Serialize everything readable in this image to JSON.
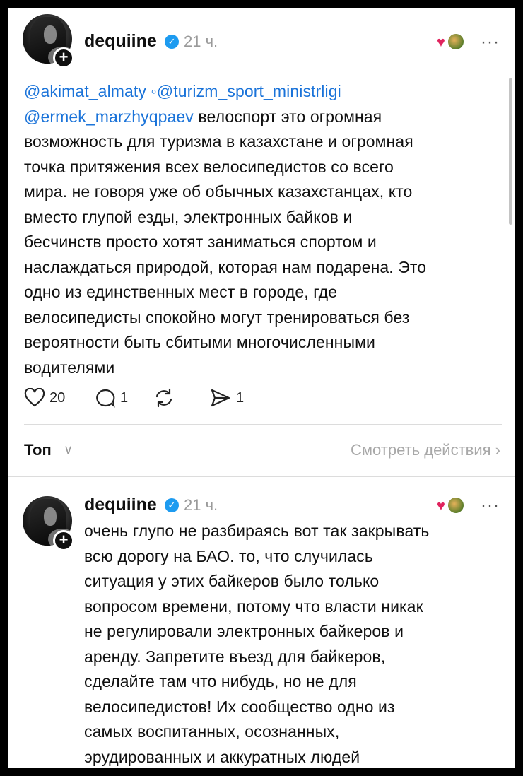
{
  "post": {
    "username": "dequiine",
    "time": "21 ч.",
    "more": "···",
    "mentions": [
      "@akimat_almaty",
      "@turizm_sport_ministrligi",
      "@ermek_marzhyqpaev"
    ],
    "lines": [
      " велоспорт это огромная",
      "возможность для туризма в казахстане и огромная",
      "точка притяжения всех велосипедистов со всего",
      "мира. не говоря уже об обычных казахстанцах, кто",
      "вместо глупой езды, электронных байков и",
      "бесчинств просто хотят заниматься спортом и",
      "наслаждаться природой, которая нам подарена. Это",
      "одно из единственных мест в городе, где",
      "велосипедисты спокойно могут тренироваться без",
      "вероятности быть сбитыми многочисленными",
      "водителями"
    ],
    "likes": "20",
    "comments": "1",
    "shares": "1"
  },
  "sort": {
    "label": "Топ",
    "chevron": "∨",
    "see_actions": "Смотреть действия ›"
  },
  "reply": {
    "username": "dequiine",
    "time": "21 ч.",
    "more": "···",
    "lines": [
      "очень глупо не разбираясь вот так закрывать",
      "всю дорогу на БАО. то, что случилась",
      "ситуация у этих байкеров было только",
      "вопросом времени, потому что власти никак",
      "не регулировали электронных байкеров и",
      "аренду. Запретите въезд для байкеров,",
      "сделайте там что нибудь, но не для",
      "велосипедистов! Их сообщество одно из",
      "самых воспитанных, осознанных,",
      "эрудированных и аккуратных людей"
    ]
  },
  "icons": {
    "heart": "heart-icon",
    "comment": "comment-icon",
    "repost": "repost-icon",
    "share": "share-icon",
    "verified": "verified-check-icon",
    "plus": "follow-plus-icon"
  },
  "colors": {
    "mention": "#1a73d9",
    "verified": "#1d9bf0",
    "muted": "#9a9a9a"
  }
}
